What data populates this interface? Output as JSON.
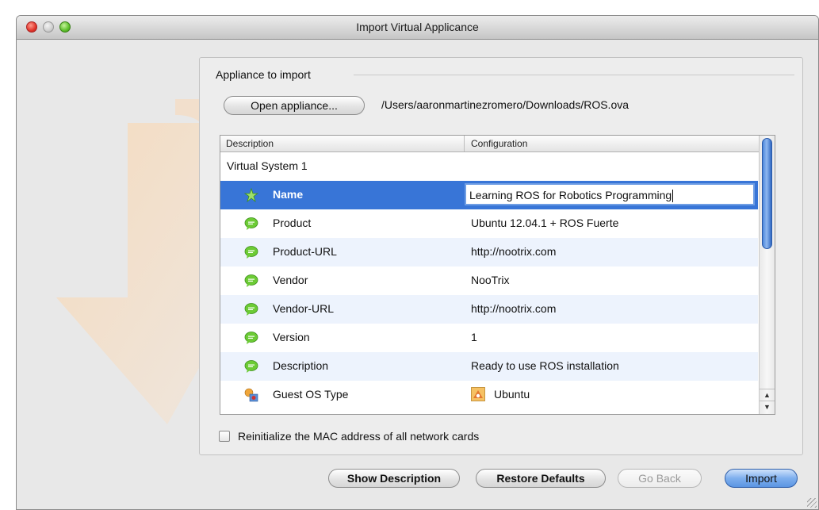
{
  "window": {
    "title": "Import Virtual Applicance"
  },
  "appliance": {
    "section_label": "Appliance to import",
    "open_button": "Open appliance...",
    "path": "/Users/aaronmartinezromero/Downloads/ROS.ova"
  },
  "table": {
    "headers": {
      "description": "Description",
      "configuration": "Configuration"
    },
    "system_label": "Virtual System 1",
    "rows": [
      {
        "label": "Name",
        "value": "Learning ROS for Robotics Programming",
        "icon": "star-icon"
      },
      {
        "label": "Product",
        "value": "Ubuntu 12.04.1 + ROS Fuerte",
        "icon": "speech-bubble-icon"
      },
      {
        "label": "Product-URL",
        "value": "http://nootrix.com",
        "icon": "speech-bubble-icon"
      },
      {
        "label": "Vendor",
        "value": "NooTrix",
        "icon": "speech-bubble-icon"
      },
      {
        "label": "Vendor-URL",
        "value": "http://nootrix.com",
        "icon": "speech-bubble-icon"
      },
      {
        "label": "Version",
        "value": "1",
        "icon": "speech-bubble-icon"
      },
      {
        "label": "Description",
        "value": "Ready to use ROS installation",
        "icon": "speech-bubble-icon"
      },
      {
        "label": "Guest OS Type",
        "value": "Ubuntu",
        "icon": "os-type-icon"
      }
    ]
  },
  "options": {
    "reinit_mac_label": "Reinitialize the MAC address of all network cards"
  },
  "buttons": {
    "show_description": "Show Description",
    "restore_defaults": "Restore Defaults",
    "go_back": "Go Back",
    "import": "Import"
  },
  "colors": {
    "selection": "#3875d7",
    "accent": "#5b95e3",
    "bubble": "#5bbf2a"
  }
}
